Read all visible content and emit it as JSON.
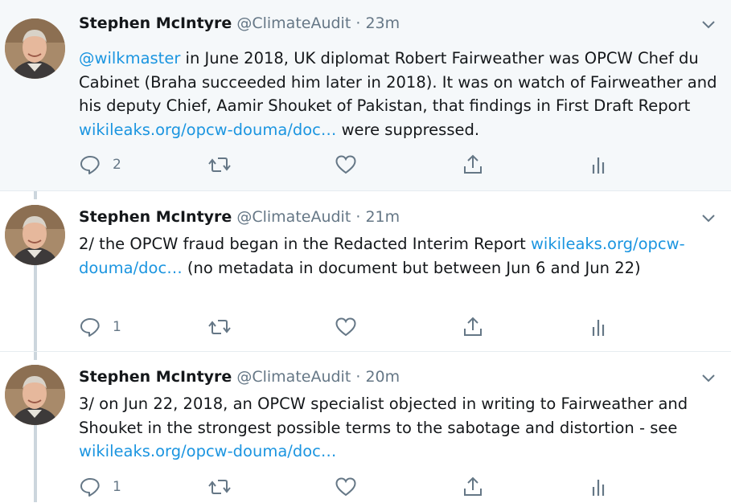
{
  "tweets": [
    {
      "author_name": "Stephen McIntyre",
      "handle": "@ClimateAudit",
      "separator": "·",
      "time": "23m",
      "mention": "@wilkmaster",
      "text_1": " in June 2018, UK diplomat Robert Fairweather was OPCW Chef du Cabinet (Braha succeeded him later in 2018). It was on watch of Fairweather and his deputy Chief, Aamir Shouket of Pakistan, that findings in First Draft Report ",
      "link": "wikileaks.org/opcw-douma/doc…",
      "text_2": " were suppressed.",
      "reply_count": "2"
    },
    {
      "author_name": "Stephen McIntyre",
      "handle": "@ClimateAudit",
      "separator": "·",
      "time": "21m",
      "text_1": "2/ the OPCW fraud began in the Redacted Interim Report ",
      "link": "wikileaks.org/opcw-douma/doc…",
      "text_2": " (no metadata in document but between Jun 6 and Jun 22)",
      "reply_count": "1"
    },
    {
      "author_name": "Stephen McIntyre",
      "handle": "@ClimateAudit",
      "separator": "·",
      "time": "20m",
      "text_1": "3/ on Jun 22, 2018, an OPCW specialist objected in writing to Fairweather and Shouket in the strongest possible terms to the sabotage and distortion - see  ",
      "link": "wikileaks.org/opcw-douma/doc…",
      "text_2": "",
      "reply_count": "1"
    }
  ],
  "icons": {
    "reply": "reply-icon",
    "retweet": "retweet-icon",
    "like": "heart-icon",
    "share": "share-icon",
    "analytics": "analytics-icon",
    "menu": "chevron-down-icon"
  },
  "colors": {
    "link": "#1b95e0",
    "icon": "#657786",
    "highlight_bg": "#f5f8fa",
    "thread_line": "#ccd6dd"
  }
}
